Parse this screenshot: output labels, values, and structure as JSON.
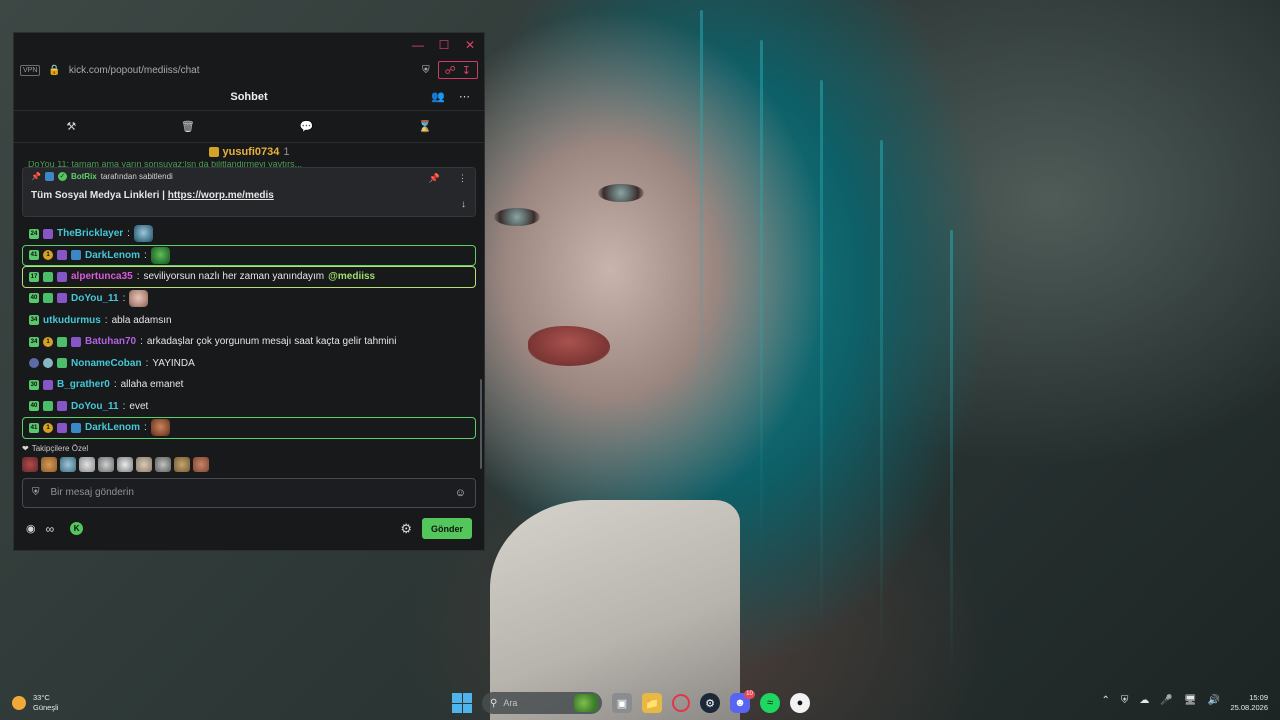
{
  "window": {
    "url": "kick.com/popout/mediiss/chat",
    "vpn_label": "VPN"
  },
  "chat": {
    "title": "Sohbet",
    "top_donor": {
      "name": "yusufi0734",
      "count": "1"
    },
    "cut_message": "DoYou 11: tamam ama yarın sonsuvaz:lsn da bilitlandirmeyi yaytırs...",
    "pinned": {
      "by_user": "BotRix",
      "by_suffix": "tarafından sabitlendi",
      "text_prefix": "Tüm Sosyal Medya Linkleri | ",
      "text_link": "https://worp.me/medis"
    },
    "messages": [
      {
        "user": "TheBricklayer",
        "text": "",
        "emote": "pepe-cap-emote"
      },
      {
        "user": "DarkLenom",
        "text": "",
        "emote": "pepe-frog-emote"
      },
      {
        "user": "alpertunca35",
        "text": "seviliyorsun nazlı her zaman yanındayım ",
        "mention": "@mediiss"
      },
      {
        "user": "DoYou_11",
        "text": "",
        "emote": "girl-face-emote"
      },
      {
        "user": "utkudurmus",
        "text": "abla adamsın"
      },
      {
        "user": "Batuhan70",
        "text": "arkadaşlar çok yorgunum mesajı saat kaçta gelir tahmini"
      },
      {
        "user": "NonameCoban",
        "text": "YAYINDA"
      },
      {
        "user": "B_grather0",
        "text": "allaha emanet"
      },
      {
        "user": "DoYou_11",
        "text": "evet"
      },
      {
        "user": "DarkLenom",
        "text": "",
        "emote": "man-face-emote"
      }
    ],
    "favorites_label": "Takipçilere Özel",
    "input_placeholder": "Bir mesaj gönderin",
    "send_label": "Gönder",
    "colors": {
      "accent": "#53c75c",
      "highlight_green": "#5dcf6a",
      "highlight_lime": "#b8df74",
      "background": "#18191b"
    }
  },
  "taskbar": {
    "weather_temp": "33°C",
    "weather_desc": "Güneşli",
    "search_label": "Ara",
    "discord_badge": "10",
    "time": "15:09",
    "date": "25.08.2026"
  }
}
